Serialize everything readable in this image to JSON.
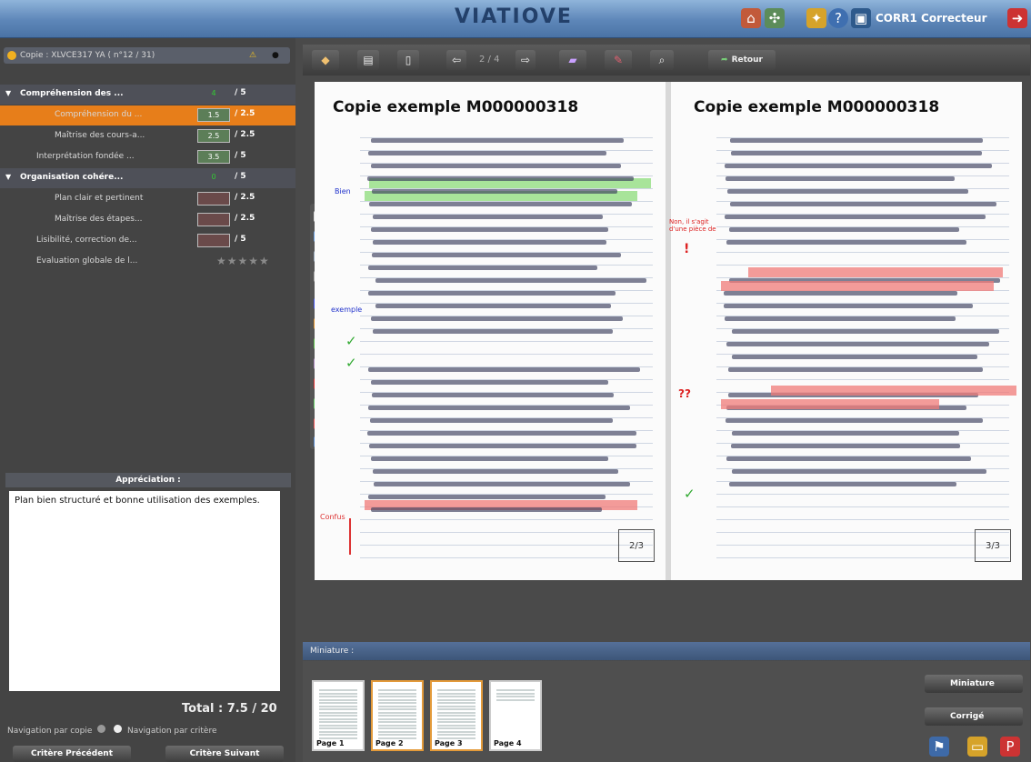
{
  "header": {
    "logo": "VIATIOVE",
    "user": "CORR1 Correcteur"
  },
  "copy": {
    "label": "Copie : XLVCE317 YA ( n°12 / 31)"
  },
  "criteria": [
    {
      "label": "Compréhension des ...",
      "score": "4",
      "max": "/ 5",
      "level": 0,
      "group": true
    },
    {
      "label": "Compréhension du ...",
      "score": "1.5",
      "max": "/ 2.5",
      "level": 1,
      "selected": true
    },
    {
      "label": "Maîtrise des cours-a...",
      "score": "2.5",
      "max": "/ 2.5",
      "level": 1
    },
    {
      "label": "Interprétation fondée ...",
      "score": "3.5",
      "max": "/ 5",
      "level": 0
    },
    {
      "label": "Organisation cohére...",
      "score": "0",
      "max": "/ 5",
      "level": 0,
      "group": true
    },
    {
      "label": "Plan clair et pertinent",
      "score": "",
      "max": "/ 2.5",
      "level": 1
    },
    {
      "label": "Maîtrise des étapes...",
      "score": "",
      "max": "/ 2.5",
      "level": 1
    },
    {
      "label": "Lisibilité, correction de...",
      "score": "",
      "max": "/ 5",
      "level": 0
    },
    {
      "label": "Evaluation globale de l...",
      "score": "",
      "max": "",
      "level": 0
    }
  ],
  "appreciation": {
    "title": "Appréciation :",
    "text": "Plan bien structuré et bonne utilisation des exemples."
  },
  "total": "Total : 7.5 / 20",
  "navigation": {
    "label": "Navigation par copie",
    "label2": "Navigation par critère",
    "prev": "Critère Précédent",
    "next": "Critère Suivant"
  },
  "toolbar": {
    "page": "2 / 4",
    "back": "Retour"
  },
  "document": {
    "title_left": "Copie exemple  M000000318",
    "title_right": "Copie exemple  M000000318",
    "margin_left": [
      "Bien",
      "exemple",
      "Confus"
    ],
    "margin_right": [
      "Non, il s'agit d'une pièce de",
      "??"
    ],
    "page_left": "2/3",
    "page_right": "3/3"
  },
  "miniature": {
    "title": "Miniature :",
    "pages": [
      "Page 1",
      "Page 2",
      "Page 3",
      "Page 4"
    ]
  },
  "side_buttons": [
    "Miniature",
    "Corrigé"
  ]
}
